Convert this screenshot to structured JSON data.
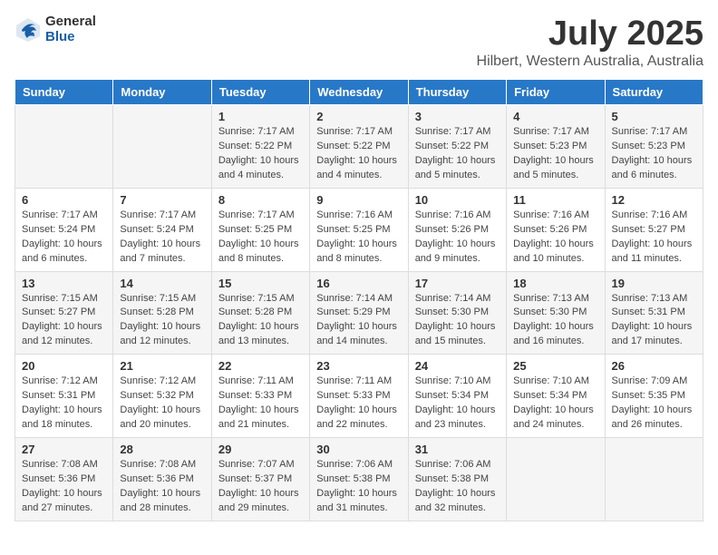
{
  "header": {
    "logo_general": "General",
    "logo_blue": "Blue",
    "month_title": "July 2025",
    "location": "Hilbert, Western Australia, Australia"
  },
  "days_of_week": [
    "Sunday",
    "Monday",
    "Tuesday",
    "Wednesday",
    "Thursday",
    "Friday",
    "Saturday"
  ],
  "weeks": [
    [
      {
        "day": "",
        "info": ""
      },
      {
        "day": "",
        "info": ""
      },
      {
        "day": "1",
        "info": "Sunrise: 7:17 AM\nSunset: 5:22 PM\nDaylight: 10 hours\nand 4 minutes."
      },
      {
        "day": "2",
        "info": "Sunrise: 7:17 AM\nSunset: 5:22 PM\nDaylight: 10 hours\nand 4 minutes."
      },
      {
        "day": "3",
        "info": "Sunrise: 7:17 AM\nSunset: 5:22 PM\nDaylight: 10 hours\nand 5 minutes."
      },
      {
        "day": "4",
        "info": "Sunrise: 7:17 AM\nSunset: 5:23 PM\nDaylight: 10 hours\nand 5 minutes."
      },
      {
        "day": "5",
        "info": "Sunrise: 7:17 AM\nSunset: 5:23 PM\nDaylight: 10 hours\nand 6 minutes."
      }
    ],
    [
      {
        "day": "6",
        "info": "Sunrise: 7:17 AM\nSunset: 5:24 PM\nDaylight: 10 hours\nand 6 minutes."
      },
      {
        "day": "7",
        "info": "Sunrise: 7:17 AM\nSunset: 5:24 PM\nDaylight: 10 hours\nand 7 minutes."
      },
      {
        "day": "8",
        "info": "Sunrise: 7:17 AM\nSunset: 5:25 PM\nDaylight: 10 hours\nand 8 minutes."
      },
      {
        "day": "9",
        "info": "Sunrise: 7:16 AM\nSunset: 5:25 PM\nDaylight: 10 hours\nand 8 minutes."
      },
      {
        "day": "10",
        "info": "Sunrise: 7:16 AM\nSunset: 5:26 PM\nDaylight: 10 hours\nand 9 minutes."
      },
      {
        "day": "11",
        "info": "Sunrise: 7:16 AM\nSunset: 5:26 PM\nDaylight: 10 hours\nand 10 minutes."
      },
      {
        "day": "12",
        "info": "Sunrise: 7:16 AM\nSunset: 5:27 PM\nDaylight: 10 hours\nand 11 minutes."
      }
    ],
    [
      {
        "day": "13",
        "info": "Sunrise: 7:15 AM\nSunset: 5:27 PM\nDaylight: 10 hours\nand 12 minutes."
      },
      {
        "day": "14",
        "info": "Sunrise: 7:15 AM\nSunset: 5:28 PM\nDaylight: 10 hours\nand 12 minutes."
      },
      {
        "day": "15",
        "info": "Sunrise: 7:15 AM\nSunset: 5:28 PM\nDaylight: 10 hours\nand 13 minutes."
      },
      {
        "day": "16",
        "info": "Sunrise: 7:14 AM\nSunset: 5:29 PM\nDaylight: 10 hours\nand 14 minutes."
      },
      {
        "day": "17",
        "info": "Sunrise: 7:14 AM\nSunset: 5:30 PM\nDaylight: 10 hours\nand 15 minutes."
      },
      {
        "day": "18",
        "info": "Sunrise: 7:13 AM\nSunset: 5:30 PM\nDaylight: 10 hours\nand 16 minutes."
      },
      {
        "day": "19",
        "info": "Sunrise: 7:13 AM\nSunset: 5:31 PM\nDaylight: 10 hours\nand 17 minutes."
      }
    ],
    [
      {
        "day": "20",
        "info": "Sunrise: 7:12 AM\nSunset: 5:31 PM\nDaylight: 10 hours\nand 18 minutes."
      },
      {
        "day": "21",
        "info": "Sunrise: 7:12 AM\nSunset: 5:32 PM\nDaylight: 10 hours\nand 20 minutes."
      },
      {
        "day": "22",
        "info": "Sunrise: 7:11 AM\nSunset: 5:33 PM\nDaylight: 10 hours\nand 21 minutes."
      },
      {
        "day": "23",
        "info": "Sunrise: 7:11 AM\nSunset: 5:33 PM\nDaylight: 10 hours\nand 22 minutes."
      },
      {
        "day": "24",
        "info": "Sunrise: 7:10 AM\nSunset: 5:34 PM\nDaylight: 10 hours\nand 23 minutes."
      },
      {
        "day": "25",
        "info": "Sunrise: 7:10 AM\nSunset: 5:34 PM\nDaylight: 10 hours\nand 24 minutes."
      },
      {
        "day": "26",
        "info": "Sunrise: 7:09 AM\nSunset: 5:35 PM\nDaylight: 10 hours\nand 26 minutes."
      }
    ],
    [
      {
        "day": "27",
        "info": "Sunrise: 7:08 AM\nSunset: 5:36 PM\nDaylight: 10 hours\nand 27 minutes."
      },
      {
        "day": "28",
        "info": "Sunrise: 7:08 AM\nSunset: 5:36 PM\nDaylight: 10 hours\nand 28 minutes."
      },
      {
        "day": "29",
        "info": "Sunrise: 7:07 AM\nSunset: 5:37 PM\nDaylight: 10 hours\nand 29 minutes."
      },
      {
        "day": "30",
        "info": "Sunrise: 7:06 AM\nSunset: 5:38 PM\nDaylight: 10 hours\nand 31 minutes."
      },
      {
        "day": "31",
        "info": "Sunrise: 7:06 AM\nSunset: 5:38 PM\nDaylight: 10 hours\nand 32 minutes."
      },
      {
        "day": "",
        "info": ""
      },
      {
        "day": "",
        "info": ""
      }
    ]
  ]
}
